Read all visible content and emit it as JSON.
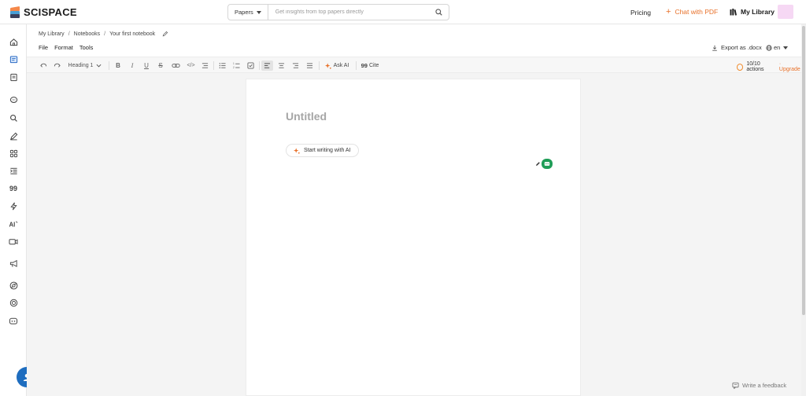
{
  "brand": {
    "name": "SCISPACE"
  },
  "search": {
    "type_label": "Papers",
    "placeholder": "Get insights from top papers directly"
  },
  "nav": {
    "pricing": "Pricing",
    "chat_pdf": "Chat with PDF",
    "my_library": "My Library"
  },
  "breadcrumb": [
    "My Library",
    "Notebooks",
    "Your first notebook"
  ],
  "menu": [
    "File",
    "Format",
    "Tools"
  ],
  "header": {
    "export": "Export as .docx",
    "lang": "en"
  },
  "toolbar": {
    "heading": "Heading 1",
    "ask_ai": "Ask AI",
    "cite": "Cite",
    "actions": "10/10 actions",
    "upgrade": "· Upgrade"
  },
  "doc": {
    "title": "Untitled",
    "ai_prompt": "Start writing with AI"
  },
  "footer": {
    "feedback": "Write a feedback"
  },
  "rail_icons": [
    "home-icon",
    "library-icon",
    "notebook-icon",
    "chat-icon",
    "search-icon",
    "pen-icon",
    "tools-icon",
    "list-icon",
    "quote-icon",
    "bolt-icon",
    "ai-icon",
    "video-icon",
    "megaphone-icon",
    "chrome-icon",
    "openai-icon",
    "discord-icon"
  ],
  "colors": {
    "accent": "#e8712a",
    "help": "#1e6dbf",
    "green": "#1f9d57"
  }
}
